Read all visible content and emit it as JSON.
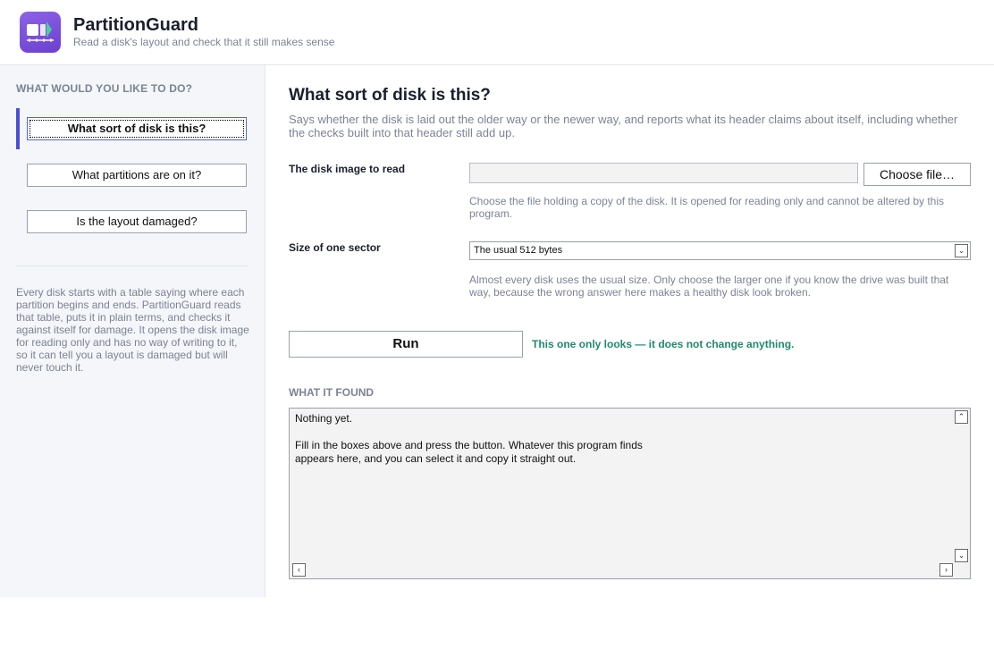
{
  "app": {
    "title": "PartitionGuard",
    "subtitle": "Read a disk's layout and check that it still makes sense",
    "logo_icon": "partition-logo-icon",
    "accent_color": "#6a3fd0"
  },
  "sidebar": {
    "heading": "WHAT WOULD YOU LIKE TO DO?",
    "items": [
      {
        "label": "What sort of disk is this?",
        "active": true
      },
      {
        "label": "What partitions are on it?",
        "active": false
      },
      {
        "label": "Is the layout damaged?",
        "active": false
      }
    ],
    "about": "Every disk starts with a table saying where each partition begins and ends. PartitionGuard reads that table, puts it in plain terms, and checks it against itself for damage. It opens the disk image for reading only and has no way of writing to it, so it can tell you a layout is damaged but will never touch it."
  },
  "main": {
    "title": "What sort of disk is this?",
    "description": "Says whether the disk is laid out the older way or the newer way, and reports what its header claims about itself, including whether the checks built into that header still add up.",
    "disk_image": {
      "label": "The disk image to read",
      "value": "",
      "choose_label": "Choose file…",
      "help": "Choose the file holding a copy of the disk. It is opened for reading only and cannot be altered by this program."
    },
    "sector_size": {
      "label": "Size of one sector",
      "selected": "The usual 512 bytes",
      "help": "Almost every disk uses the usual size. Only choose the larger one if you know the drive was built that way, because the wrong answer here makes a healthy disk look broken."
    },
    "run": {
      "label": "Run",
      "note": "This one only looks — it does not change anything.",
      "note_color": "#1e8a6e"
    },
    "results": {
      "heading": "WHAT IT FOUND",
      "text": "Nothing yet.\n\nFill in the boxes above and press the button. Whatever this program finds\nappears here, and you can select it and copy it straight out."
    }
  }
}
